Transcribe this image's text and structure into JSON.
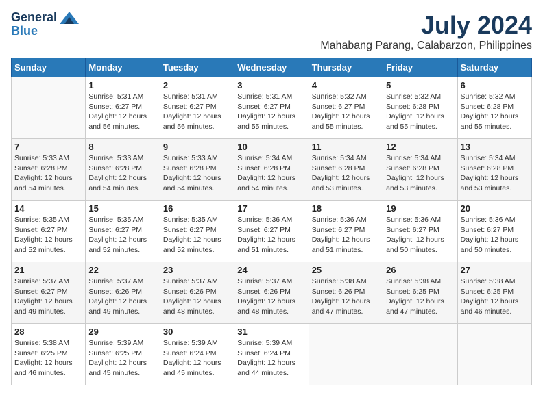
{
  "header": {
    "logo_general": "General",
    "logo_blue": "Blue",
    "month_title": "July 2024",
    "location": "Mahabang Parang, Calabarzon, Philippines"
  },
  "calendar": {
    "weekdays": [
      "Sunday",
      "Monday",
      "Tuesday",
      "Wednesday",
      "Thursday",
      "Friday",
      "Saturday"
    ],
    "weeks": [
      [
        {
          "day": "",
          "info": ""
        },
        {
          "day": "1",
          "info": "Sunrise: 5:31 AM\nSunset: 6:27 PM\nDaylight: 12 hours\nand 56 minutes."
        },
        {
          "day": "2",
          "info": "Sunrise: 5:31 AM\nSunset: 6:27 PM\nDaylight: 12 hours\nand 56 minutes."
        },
        {
          "day": "3",
          "info": "Sunrise: 5:31 AM\nSunset: 6:27 PM\nDaylight: 12 hours\nand 55 minutes."
        },
        {
          "day": "4",
          "info": "Sunrise: 5:32 AM\nSunset: 6:27 PM\nDaylight: 12 hours\nand 55 minutes."
        },
        {
          "day": "5",
          "info": "Sunrise: 5:32 AM\nSunset: 6:28 PM\nDaylight: 12 hours\nand 55 minutes."
        },
        {
          "day": "6",
          "info": "Sunrise: 5:32 AM\nSunset: 6:28 PM\nDaylight: 12 hours\nand 55 minutes."
        }
      ],
      [
        {
          "day": "7",
          "info": "Sunrise: 5:33 AM\nSunset: 6:28 PM\nDaylight: 12 hours\nand 54 minutes."
        },
        {
          "day": "8",
          "info": "Sunrise: 5:33 AM\nSunset: 6:28 PM\nDaylight: 12 hours\nand 54 minutes."
        },
        {
          "day": "9",
          "info": "Sunrise: 5:33 AM\nSunset: 6:28 PM\nDaylight: 12 hours\nand 54 minutes."
        },
        {
          "day": "10",
          "info": "Sunrise: 5:34 AM\nSunset: 6:28 PM\nDaylight: 12 hours\nand 54 minutes."
        },
        {
          "day": "11",
          "info": "Sunrise: 5:34 AM\nSunset: 6:28 PM\nDaylight: 12 hours\nand 53 minutes."
        },
        {
          "day": "12",
          "info": "Sunrise: 5:34 AM\nSunset: 6:28 PM\nDaylight: 12 hours\nand 53 minutes."
        },
        {
          "day": "13",
          "info": "Sunrise: 5:34 AM\nSunset: 6:28 PM\nDaylight: 12 hours\nand 53 minutes."
        }
      ],
      [
        {
          "day": "14",
          "info": "Sunrise: 5:35 AM\nSunset: 6:27 PM\nDaylight: 12 hours\nand 52 minutes."
        },
        {
          "day": "15",
          "info": "Sunrise: 5:35 AM\nSunset: 6:27 PM\nDaylight: 12 hours\nand 52 minutes."
        },
        {
          "day": "16",
          "info": "Sunrise: 5:35 AM\nSunset: 6:27 PM\nDaylight: 12 hours\nand 52 minutes."
        },
        {
          "day": "17",
          "info": "Sunrise: 5:36 AM\nSunset: 6:27 PM\nDaylight: 12 hours\nand 51 minutes."
        },
        {
          "day": "18",
          "info": "Sunrise: 5:36 AM\nSunset: 6:27 PM\nDaylight: 12 hours\nand 51 minutes."
        },
        {
          "day": "19",
          "info": "Sunrise: 5:36 AM\nSunset: 6:27 PM\nDaylight: 12 hours\nand 50 minutes."
        },
        {
          "day": "20",
          "info": "Sunrise: 5:36 AM\nSunset: 6:27 PM\nDaylight: 12 hours\nand 50 minutes."
        }
      ],
      [
        {
          "day": "21",
          "info": "Sunrise: 5:37 AM\nSunset: 6:27 PM\nDaylight: 12 hours\nand 49 minutes."
        },
        {
          "day": "22",
          "info": "Sunrise: 5:37 AM\nSunset: 6:26 PM\nDaylight: 12 hours\nand 49 minutes."
        },
        {
          "day": "23",
          "info": "Sunrise: 5:37 AM\nSunset: 6:26 PM\nDaylight: 12 hours\nand 48 minutes."
        },
        {
          "day": "24",
          "info": "Sunrise: 5:37 AM\nSunset: 6:26 PM\nDaylight: 12 hours\nand 48 minutes."
        },
        {
          "day": "25",
          "info": "Sunrise: 5:38 AM\nSunset: 6:26 PM\nDaylight: 12 hours\nand 47 minutes."
        },
        {
          "day": "26",
          "info": "Sunrise: 5:38 AM\nSunset: 6:25 PM\nDaylight: 12 hours\nand 47 minutes."
        },
        {
          "day": "27",
          "info": "Sunrise: 5:38 AM\nSunset: 6:25 PM\nDaylight: 12 hours\nand 46 minutes."
        }
      ],
      [
        {
          "day": "28",
          "info": "Sunrise: 5:38 AM\nSunset: 6:25 PM\nDaylight: 12 hours\nand 46 minutes."
        },
        {
          "day": "29",
          "info": "Sunrise: 5:39 AM\nSunset: 6:25 PM\nDaylight: 12 hours\nand 45 minutes."
        },
        {
          "day": "30",
          "info": "Sunrise: 5:39 AM\nSunset: 6:24 PM\nDaylight: 12 hours\nand 45 minutes."
        },
        {
          "day": "31",
          "info": "Sunrise: 5:39 AM\nSunset: 6:24 PM\nDaylight: 12 hours\nand 44 minutes."
        },
        {
          "day": "",
          "info": ""
        },
        {
          "day": "",
          "info": ""
        },
        {
          "day": "",
          "info": ""
        }
      ]
    ]
  }
}
